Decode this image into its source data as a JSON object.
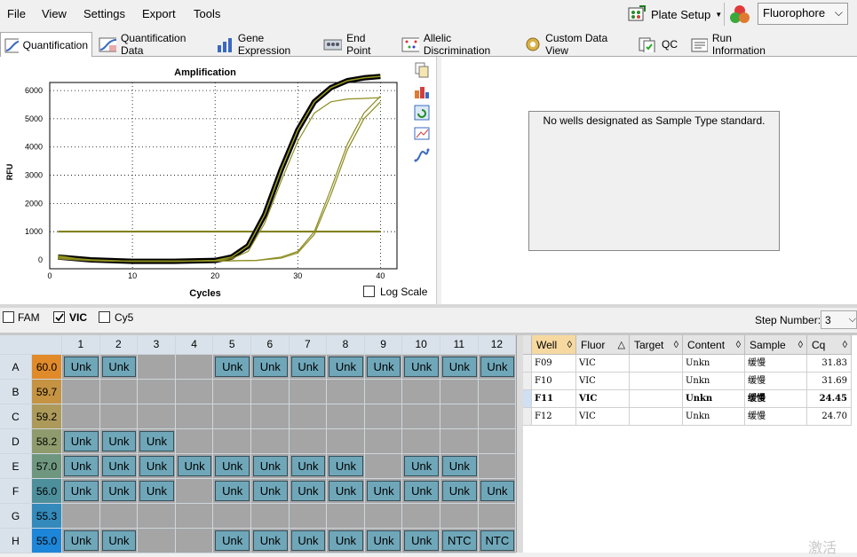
{
  "menu": {
    "items": [
      "File",
      "View",
      "Settings",
      "Export",
      "Tools"
    ],
    "plate_setup": "Plate Setup",
    "fluorophore": "Fluorophore"
  },
  "tabs": [
    "Quantification",
    "Quantification Data",
    "Gene Expression",
    "End Point",
    "Allelic Discrimination",
    "Custom Data View",
    "QC",
    "Run Information"
  ],
  "chart_data": {
    "type": "line",
    "title": "Amplification",
    "xlabel": "Cycles",
    "ylabel": "RFU",
    "xlim": [
      0,
      42
    ],
    "ylim": [
      0,
      6600
    ],
    "xticks": [
      0,
      10,
      20,
      30,
      40
    ],
    "yticks": [
      0,
      1000,
      2000,
      3000,
      4000,
      5000,
      6000
    ],
    "threshold": 1000,
    "series": [
      {
        "x": [
          1,
          5,
          10,
          15,
          20,
          22,
          24,
          26,
          28,
          30,
          32,
          34,
          36,
          38,
          40
        ],
        "values": [
          100,
          0,
          -50,
          -50,
          -20,
          100,
          500,
          1600,
          3200,
          4600,
          5600,
          6100,
          6350,
          6450,
          6500
        ],
        "highlight": true
      },
      {
        "x": [
          1,
          5,
          10,
          15,
          20,
          22,
          24,
          26,
          28,
          30,
          32,
          34,
          36,
          38,
          40
        ],
        "values": [
          150,
          -30,
          -60,
          -60,
          -40,
          40,
          300,
          1300,
          2800,
          4200,
          5200,
          5600,
          5700,
          5720,
          5750
        ]
      },
      {
        "x": [
          1,
          5,
          10,
          15,
          20,
          25,
          28,
          30,
          32,
          34,
          36,
          38,
          40
        ],
        "values": [
          40,
          -30,
          -40,
          -40,
          -40,
          -20,
          100,
          300,
          1000,
          2500,
          4100,
          5200,
          5800
        ]
      },
      {
        "x": [
          1,
          5,
          10,
          15,
          20,
          25,
          28,
          30,
          32,
          34,
          36,
          38,
          40
        ],
        "values": [
          60,
          -20,
          -40,
          -40,
          -40,
          -20,
          60,
          250,
          900,
          2300,
          3900,
          5000,
          5600
        ]
      }
    ]
  },
  "log_scale_label": "Log Scale",
  "no_standard_msg": "No wells designated as Sample Type standard.",
  "fluors": [
    "FAM",
    "VIC",
    "Cy5"
  ],
  "step_label": "Step Number:",
  "step_value": "3",
  "grid": {
    "cols": [
      "1",
      "2",
      "3",
      "4",
      "5",
      "6",
      "7",
      "8",
      "9",
      "10",
      "11",
      "12"
    ],
    "rows": [
      {
        "label": "A",
        "temp": "60.0",
        "color": "#e08a2a",
        "cells": [
          "Unk",
          "Unk",
          "",
          "",
          "Unk",
          "Unk",
          "Unk",
          "Unk",
          "Unk",
          "Unk",
          "Unk",
          "Unk"
        ]
      },
      {
        "label": "B",
        "temp": "59.7",
        "color": "#c59342",
        "cells": [
          "",
          "",
          "",
          "",
          "",
          "",
          "",
          "",
          "",
          "",
          "",
          ""
        ]
      },
      {
        "label": "C",
        "temp": "59.2",
        "color": "#ad9a5a",
        "cells": [
          "",
          "",
          "",
          "",
          "",
          "",
          "",
          "",
          "",
          "",
          "",
          ""
        ]
      },
      {
        "label": "D",
        "temp": "58.2",
        "color": "#8f9b6c",
        "cells": [
          "Unk",
          "Unk",
          "Unk",
          "",
          "",
          "",
          "",
          "",
          "",
          "",
          "",
          ""
        ]
      },
      {
        "label": "E",
        "temp": "57.0",
        "color": "#6f977f",
        "cells": [
          "Unk",
          "Unk",
          "Unk",
          "Unk",
          "Unk",
          "Unk",
          "Unk",
          "Unk",
          "",
          "Unk",
          "Unk",
          ""
        ]
      },
      {
        "label": "F",
        "temp": "56.0",
        "color": "#4e8f9c",
        "cells": [
          "Unk",
          "Unk",
          "Unk",
          "",
          "Unk",
          "Unk",
          "Unk",
          "Unk",
          "Unk",
          "Unk",
          "Unk",
          "Unk"
        ]
      },
      {
        "label": "G",
        "temp": "55.3",
        "color": "#338abb",
        "cells": [
          "",
          "",
          "",
          "",
          "",
          "",
          "",
          "",
          "",
          "",
          "",
          ""
        ]
      },
      {
        "label": "H",
        "temp": "55.0",
        "color": "#1d86d8",
        "cells": [
          "Unk",
          "Unk",
          "",
          "",
          "Unk",
          "Unk",
          "Unk",
          "Unk",
          "Unk",
          "Unk",
          "NTC",
          "NTC"
        ]
      }
    ]
  },
  "table": {
    "headers": [
      "Well",
      "Fluor",
      "Target",
      "Content",
      "Sample",
      "Cq"
    ],
    "rows": [
      [
        "F09",
        "VIC",
        "",
        "Unkn",
        "缓慢",
        "31.83"
      ],
      [
        "F10",
        "VIC",
        "",
        "Unkn",
        "缓慢",
        "31.69"
      ],
      [
        "F11",
        "VIC",
        "",
        "Unkn",
        "缓慢",
        "24.45"
      ],
      [
        "F12",
        "VIC",
        "",
        "Unkn",
        "缓慢",
        "24.70"
      ]
    ]
  },
  "watermark": "激活"
}
